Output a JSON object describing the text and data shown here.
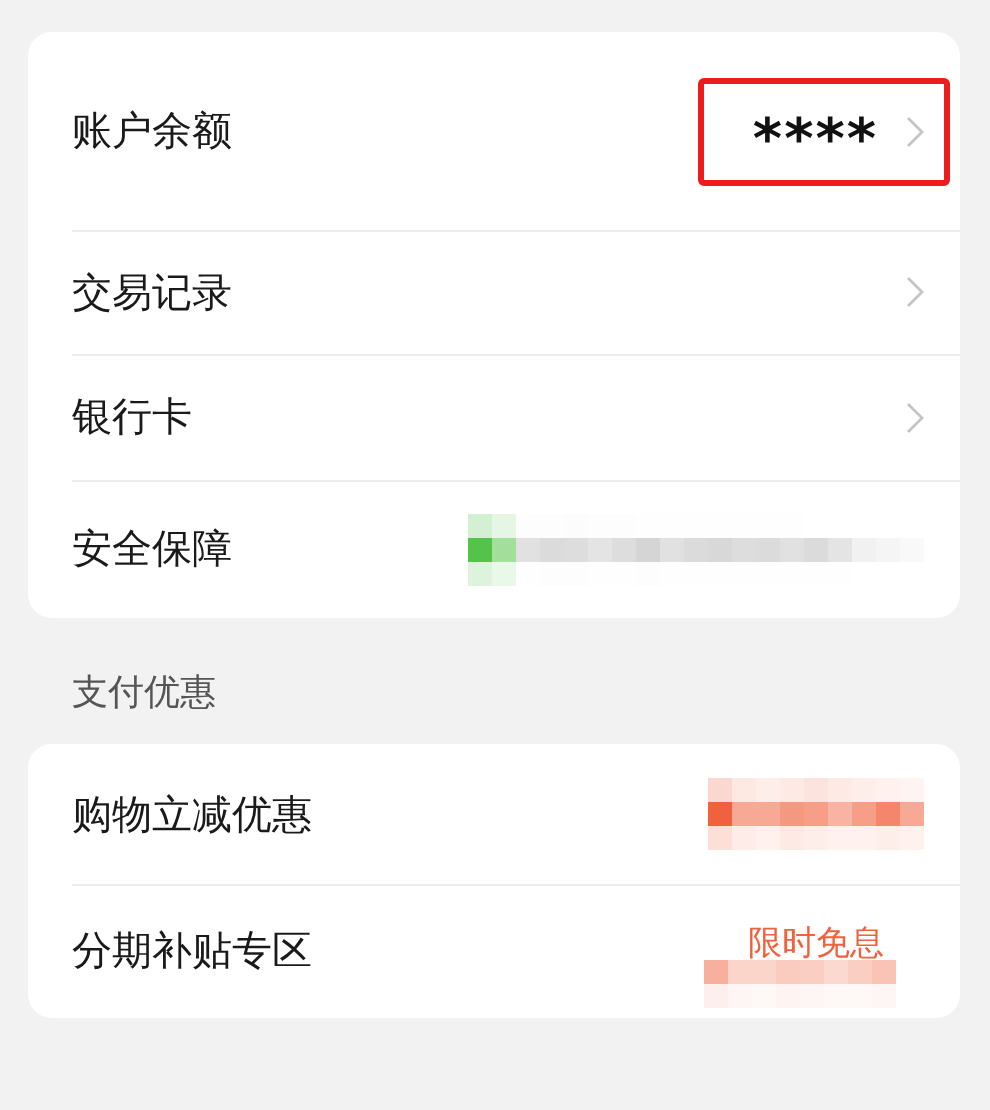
{
  "account_card": {
    "rows": [
      {
        "kind": "balance",
        "label": "账户余额",
        "value": "****",
        "chevron": true,
        "highlighted": true
      },
      {
        "kind": "link",
        "label": "交易记录",
        "chevron": true
      },
      {
        "kind": "link",
        "label": "银行卡",
        "chevron": true
      },
      {
        "kind": "masked",
        "label": "安全保障",
        "color": "#55c24a"
      }
    ]
  },
  "section_title": "支付优惠",
  "offers_card": {
    "rows": [
      {
        "kind": "masked",
        "label": "购物立减优惠",
        "color": "#f0623e"
      },
      {
        "kind": "masked-tag",
        "label": "分期补贴专区",
        "tag": "限时免息",
        "color": "#f0623e"
      }
    ]
  }
}
